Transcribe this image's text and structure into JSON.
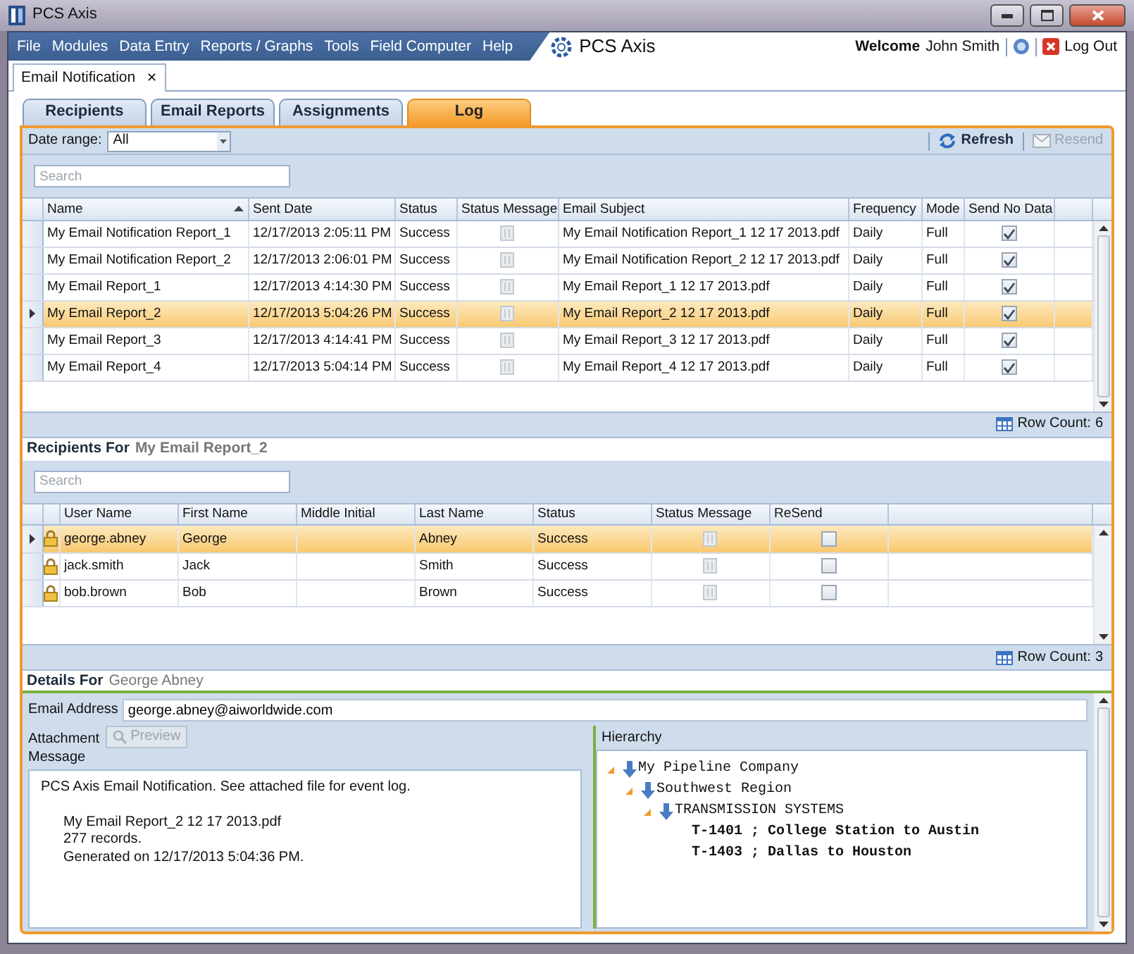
{
  "window": {
    "title": "PCS Axis"
  },
  "menu": [
    "File",
    "Modules",
    "Data Entry",
    "Reports / Graphs",
    "Tools",
    "Field Computer",
    "Help"
  ],
  "app_title": "PCS Axis",
  "user": {
    "welcome": "Welcome",
    "name": "John Smith",
    "logout": "Log Out"
  },
  "doc_tabs": [
    {
      "label": "Email Notification",
      "close": "✕",
      "selected": true
    }
  ],
  "tabs": [
    {
      "label": "Recipients",
      "selected": false
    },
    {
      "label": "Email Reports",
      "selected": false
    },
    {
      "label": "Assignments",
      "selected": false
    },
    {
      "label": "Log",
      "selected": true
    }
  ],
  "toolbar": {
    "date_range_label": "Date range:",
    "date_range_value": "All",
    "buttons": [
      {
        "label": "Refresh",
        "kind": "refresh",
        "disabled": false
      },
      {
        "label": "Resend",
        "kind": "mail",
        "disabled": true
      }
    ]
  },
  "log_grid": {
    "search_placeholder": "Search",
    "columns": [
      {
        "label": "Name",
        "sorted": true
      },
      {
        "label": "Sent Date"
      },
      {
        "label": "Status"
      },
      {
        "label": "Status Message",
        "kind": "icon"
      },
      {
        "label": "Email Subject"
      },
      {
        "label": "Frequency"
      },
      {
        "label": "Mode"
      },
      {
        "label": "Send No Data",
        "kind": "check"
      }
    ],
    "rows": [
      {
        "cells": [
          "My Email Notification Report_1",
          "12/17/2013 2:05:11 PM",
          "Success",
          "",
          "My Email Notification Report_1 12 17 2013.pdf",
          "Daily",
          "Full",
          ""
        ],
        "checked": true,
        "selected": false
      },
      {
        "cells": [
          "My Email Notification Report_2",
          "12/17/2013 2:06:01 PM",
          "Success",
          "",
          "My Email Notification Report_2 12 17 2013.pdf",
          "Daily",
          "Full",
          ""
        ],
        "checked": true,
        "selected": false
      },
      {
        "cells": [
          "My Email Report_1",
          "12/17/2013 4:14:30 PM",
          "Success",
          "",
          "My Email Report_1 12 17 2013.pdf",
          "Daily",
          "Full",
          ""
        ],
        "checked": true,
        "selected": false
      },
      {
        "cells": [
          "My Email Report_2",
          "12/17/2013 5:04:26 PM",
          "Success",
          "",
          "My Email Report_2 12 17 2013.pdf",
          "Daily",
          "Full",
          ""
        ],
        "checked": true,
        "selected": true
      },
      {
        "cells": [
          "My Email Report_3",
          "12/17/2013 4:14:41 PM",
          "Success",
          "",
          "My Email Report_3 12 17 2013.pdf",
          "Daily",
          "Full",
          ""
        ],
        "checked": true,
        "selected": false
      },
      {
        "cells": [
          "My Email Report_4",
          "12/17/2013 5:04:14 PM",
          "Success",
          "",
          "My Email Report_4 12 17 2013.pdf",
          "Daily",
          "Full",
          ""
        ],
        "checked": true,
        "selected": false
      }
    ],
    "row_count_label": "Row Count:",
    "row_count": "6"
  },
  "recipients": {
    "heading": "Recipients For",
    "report": "My Email Report_2",
    "search_placeholder": "Search",
    "columns": [
      {
        "kind": "lock"
      },
      {
        "label": "User Name"
      },
      {
        "label": "First Name"
      },
      {
        "label": "Middle Initial"
      },
      {
        "label": "Last Name"
      },
      {
        "label": "Status"
      },
      {
        "label": "Status Message",
        "kind": "icon"
      },
      {
        "label": "ReSend",
        "kind": "check"
      }
    ],
    "rows": [
      {
        "cells": [
          "",
          "george.abney",
          "George",
          "",
          "Abney",
          "Success",
          "",
          ""
        ],
        "checked": false,
        "selected": true
      },
      {
        "cells": [
          "",
          "jack.smith",
          "Jack",
          "",
          "Smith",
          "Success",
          "",
          ""
        ],
        "checked": false,
        "selected": false
      },
      {
        "cells": [
          "",
          "bob.brown",
          "Bob",
          "",
          "Brown",
          "Success",
          "",
          ""
        ],
        "checked": false,
        "selected": false
      }
    ],
    "row_count_label": "Row Count:",
    "row_count": "3"
  },
  "details": {
    "heading": "Details For",
    "person": "George Abney",
    "email_label": "Email Address",
    "email": "george.abney@aiworldwide.com",
    "attachment_label": "Attachment",
    "preview": {
      "label": "Preview",
      "disabled": true
    },
    "message_label": "Message",
    "message": {
      "intro": "PCS Axis Email Notification.  See attached file for event log.",
      "lines": [
        "My Email Report_2 12 17 2013.pdf",
        "277 records.",
        "Generated on 12/17/2013 5:04:36 PM."
      ]
    },
    "hierarchy_label": "Hierarchy",
    "tree": [
      {
        "label": "My Pipeline Company",
        "kind": "node",
        "expanded": true,
        "children": [
          {
            "label": "Southwest Region",
            "kind": "node",
            "expanded": true,
            "children": [
              {
                "label": "TRANSMISSION SYSTEMS",
                "kind": "node",
                "expanded": true,
                "children": [
                  {
                    "label": "T-1401 ; College Station to Austin",
                    "kind": "leaf"
                  },
                  {
                    "label": "T-1403 ; Dallas to Houston",
                    "kind": "leaf"
                  }
                ]
              }
            ]
          }
        ]
      }
    ]
  }
}
